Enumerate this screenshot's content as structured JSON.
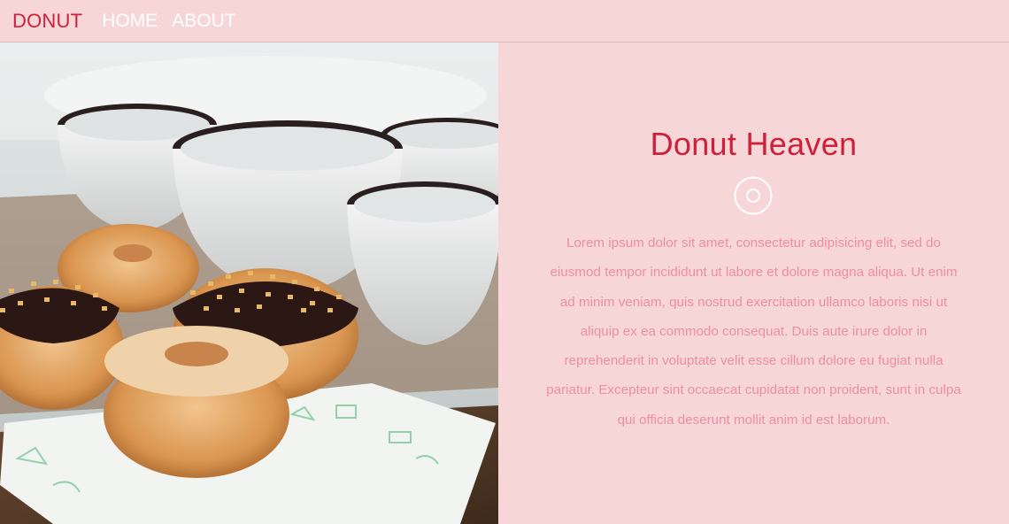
{
  "navbar": {
    "brand": "DONUT",
    "links": [
      "HOME",
      "ABOUT"
    ]
  },
  "hero": {
    "image_icon": "donuts-and-cups-photo"
  },
  "content": {
    "title": "Donut Heaven",
    "icon": "circle-target-icon",
    "body": "Lorem ipsum dolor sit amet, consectetur adipisicing elit, sed do eiusmod tempor incididunt ut labore et dolore magna aliqua. Ut enim ad minim veniam, quis nostrud exercitation ullamco laboris nisi ut aliquip ex ea commodo consequat. Duis aute irure dolor in reprehenderit in voluptate velit esse cillum dolore eu fugiat nulla pariatur. Excepteur sint occaecat cupidatat non proident, sunt in culpa qui officia deserunt mollit anim id est laborum."
  },
  "colors": {
    "background": "#f6d6d6",
    "brand": "#cf1f39",
    "body_text": "#ee8ea5",
    "nav_link": "#ffffff"
  }
}
